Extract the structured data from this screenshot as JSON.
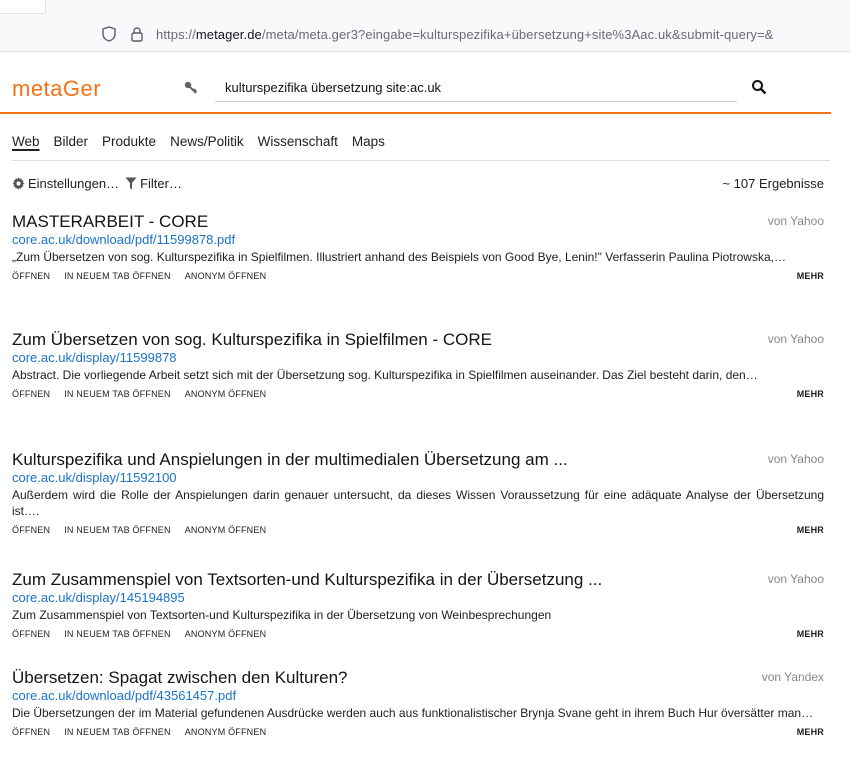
{
  "browser": {
    "url_prefix": "https://",
    "url_domain": "metager.de",
    "url_rest": "/meta/meta.ger3?eingabe=kulturspezifika+übersetzung+site%3Aac.uk&submit-query=&"
  },
  "header": {
    "logo": "metaGer",
    "query": "kulturspezifika übersetzung site:ac.uk",
    "accent_color": "#f47216"
  },
  "tabs": [
    {
      "label": "Web"
    },
    {
      "label": "Bilder"
    },
    {
      "label": "Produkte"
    },
    {
      "label": "News/Politik"
    },
    {
      "label": "Wissenschaft"
    },
    {
      "label": "Maps"
    }
  ],
  "settings": {
    "settings_label": "Einstellungen…",
    "filter_label": "Filter…",
    "result_count": "~ 107 Ergebnisse"
  },
  "actions": {
    "open": "ÖFFNEN",
    "new_tab": "IN NEUEM TAB ÖFFNEN",
    "anon": "ANONYM ÖFFNEN",
    "more": "MEHR"
  },
  "results": [
    {
      "title": "MASTERARBEIT - CORE",
      "source": "von Yahoo",
      "url": "core.ac.uk/download/pdf/11599878.pdf",
      "snippet": "„Zum Übersetzen von sog. Kulturspezifika in Spielfilmen. Illustriert anhand des Beispiels von Good Bye, Lenin!\" Verfasserin Paulina Piotrowska,…"
    },
    {
      "title": "Zum Übersetzen von sog. Kulturspezifika in Spielfilmen - CORE",
      "source": "von Yahoo",
      "url": "core.ac.uk/display/11599878",
      "snippet": "Abstract. Die vorliegende Arbeit setzt sich mit der Übersetzung sog. Kulturspezifika in Spielfilmen auseinander. Das Ziel besteht darin, den…"
    },
    {
      "title": "Kulturspezifika und Anspielungen in der multimedialen Übersetzung am ...",
      "source": "von Yahoo",
      "url": "core.ac.uk/display/11592100",
      "snippet": "Außerdem wird die Rolle der Anspielungen darin genauer untersucht, da dieses Wissen Voraussetzung für eine adäquate Analyse der Übersetzung ist…."
    },
    {
      "title": "Zum Zusammenspiel von Textsorten-und Kulturspezifika in der Übersetzung ...",
      "source": "von Yahoo",
      "url": "core.ac.uk/display/145194895",
      "snippet": "Zum Zusammenspiel von Textsorten-und Kulturspezifika in der Übersetzung von Weinbesprechungen"
    },
    {
      "title": "Übersetzen: Spagat zwischen den Kulturen?",
      "source": "von Yandex",
      "url": "core.ac.uk/download/pdf/43561457.pdf",
      "snippet": "Die Übersetzungen der im Material gefundenen Ausdrücke werden auch aus funktionalistischer Brynja Svane geht in ihrem Buch Hur översätter man…"
    }
  ]
}
